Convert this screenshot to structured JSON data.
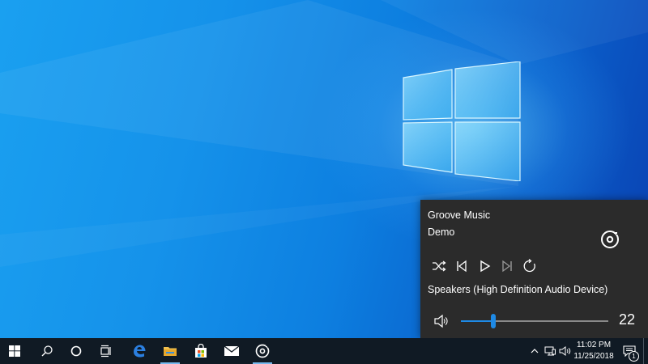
{
  "flyout": {
    "app_name": "Groove Music",
    "track_title": "Demo",
    "device_name": "Speakers (High Definition Audio Device)",
    "volume": 22,
    "volume_level": 0.22,
    "controls": [
      "shuffle",
      "previous",
      "play",
      "next",
      "repeat"
    ]
  },
  "taskbar": {
    "pinned": [
      "start",
      "search",
      "cortana",
      "task-view",
      "edge",
      "file-explorer",
      "store",
      "mail",
      "groove-music"
    ],
    "clock_time": "11:02 PM",
    "clock_date": "11/25/2018",
    "notification_count": "1"
  },
  "colors": {
    "accent": "#1e8ae6",
    "flyout_bg": "#2b2b2b",
    "taskbar_bg": "#101a24"
  }
}
